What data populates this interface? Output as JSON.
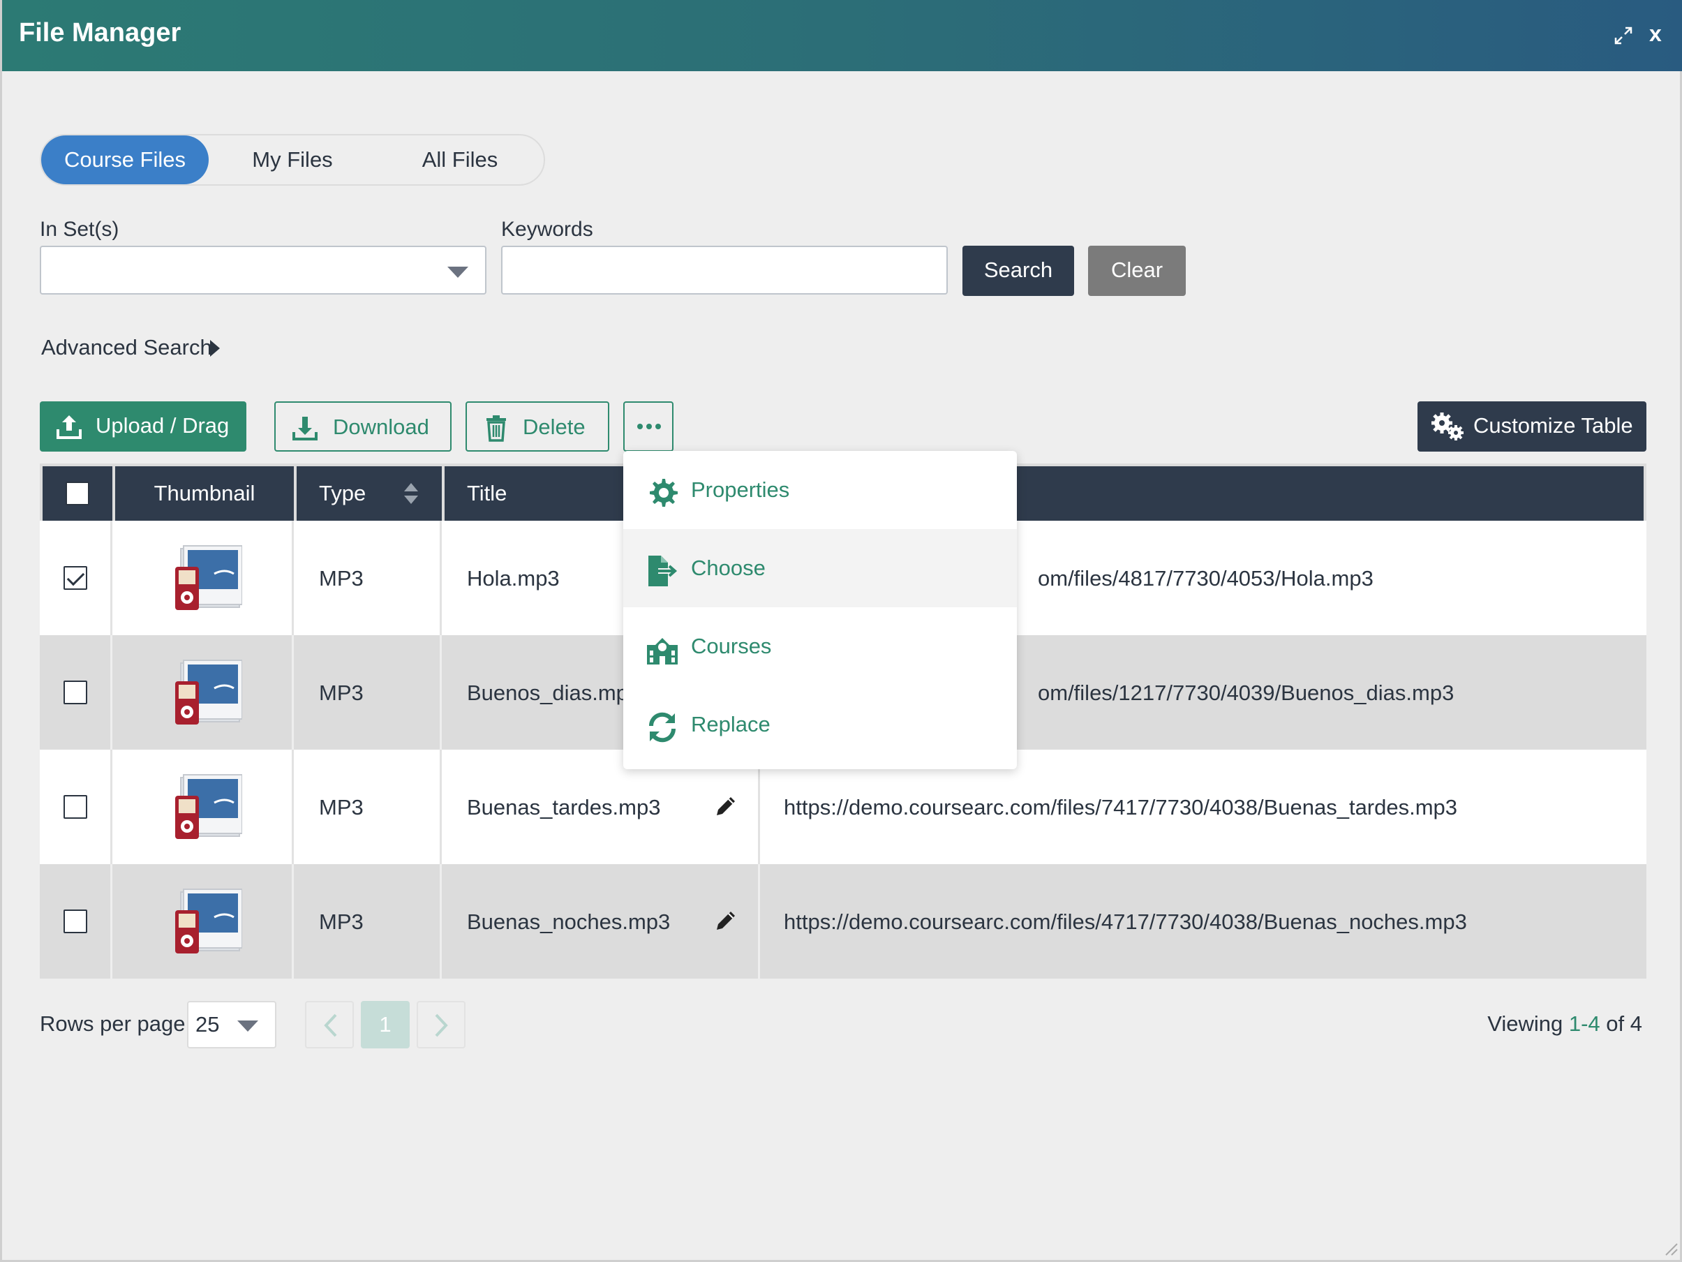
{
  "window": {
    "title": "File Manager",
    "close_label": "x"
  },
  "tabs": [
    {
      "label": "Course Files",
      "active": true
    },
    {
      "label": "My Files",
      "active": false
    },
    {
      "label": "All Files",
      "active": false
    }
  ],
  "search": {
    "sets_label": "In Set(s)",
    "sets_value": "",
    "keywords_label": "Keywords",
    "keywords_value": "",
    "search_button": "Search",
    "clear_button": "Clear",
    "advanced_label": "Advanced Search"
  },
  "toolbar": {
    "upload_label": "Upload / Drag",
    "download_label": "Download",
    "delete_label": "Delete",
    "more_icon": "ellipsis-icon",
    "customize_label": "Customize Table"
  },
  "table": {
    "columns": [
      "Thumbnail",
      "Type",
      "Title"
    ],
    "rows": [
      {
        "checked": true,
        "type": "MP3",
        "title": "Hola.mp3",
        "url_visible": "om/files/4817/7730/4053/Hola.mp3"
      },
      {
        "checked": false,
        "type": "MP3",
        "title": "Buenos_dias.mp3",
        "url_visible": "om/files/1217/7730/4039/Buenos_dias.mp3"
      },
      {
        "checked": false,
        "type": "MP3",
        "title": "Buenas_tardes.mp3",
        "url_visible": "https://demo.coursearc.com/files/7417/7730/4038/Buenas_tardes.mp3"
      },
      {
        "checked": false,
        "type": "MP3",
        "title": "Buenas_noches.mp3",
        "url_visible": "https://demo.coursearc.com/files/4717/7730/4038/Buenas_noches.mp3"
      }
    ]
  },
  "menu": {
    "items": [
      {
        "label": "Properties",
        "icon": "gear-icon"
      },
      {
        "label": "Choose",
        "icon": "file-export-icon"
      },
      {
        "label": "Courses",
        "icon": "school-icon"
      },
      {
        "label": "Replace",
        "icon": "refresh-icon"
      }
    ]
  },
  "pagination": {
    "rows_per_page_label": "Rows per page",
    "rows_per_page_value": "25",
    "current_page": "1",
    "viewing_prefix": "Viewing",
    "viewing_range": "1-4",
    "viewing_suffix": "of 4"
  },
  "colors": {
    "titlebar_start": "#2c7a74",
    "titlebar_end": "#295b80",
    "accent_green": "#2e8a6e",
    "tab_active_blue": "#3b7fc8",
    "dark_navy": "#2f3b4c"
  }
}
